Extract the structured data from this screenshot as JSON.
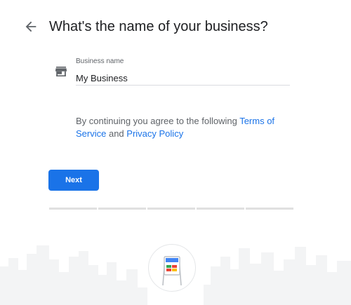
{
  "header": {
    "back_icon": "arrow-back-icon",
    "title": "What's the name of your business?"
  },
  "form": {
    "field_icon": "storefront-icon",
    "business_name_label": "Business name",
    "business_name_value": "My Business"
  },
  "consent": {
    "prefix": "By continuing you agree to the following ",
    "terms_link": "Terms of Service",
    "connector": " and ",
    "privacy_link": "Privacy Policy"
  },
  "actions": {
    "next_label": "Next"
  },
  "progress": {
    "steps_total": 5
  },
  "footer": {
    "illustration_icon": "storefront-sign-icon"
  },
  "colors": {
    "accent": "#1a73e8",
    "text_primary": "#202124",
    "text_secondary": "#5f6368",
    "progress_track": "#e0e0e0",
    "skyline": "#f3f4f5"
  }
}
